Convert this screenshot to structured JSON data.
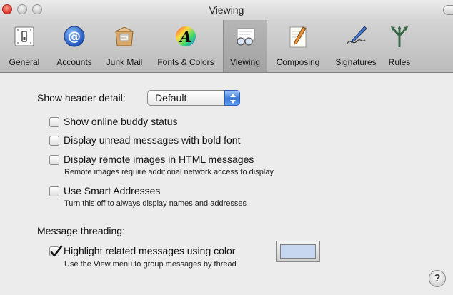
{
  "window": {
    "title": "Viewing"
  },
  "toolbar": {
    "items": [
      {
        "label": "General",
        "icon": "general-switch-icon"
      },
      {
        "label": "Accounts",
        "icon": "at-sign-icon"
      },
      {
        "label": "Junk Mail",
        "icon": "junk-mail-icon"
      },
      {
        "label": "Fonts & Colors",
        "icon": "fonts-colors-icon"
      },
      {
        "label": "Viewing",
        "icon": "viewing-glasses-icon",
        "selected": true
      },
      {
        "label": "Composing",
        "icon": "composing-pencil-icon"
      },
      {
        "label": "Signatures",
        "icon": "signature-pen-icon"
      },
      {
        "label": "Rules",
        "icon": "rules-arrows-icon"
      }
    ]
  },
  "header_detail": {
    "label": "Show header detail:",
    "selected": "Default"
  },
  "options": {
    "buddy_status": {
      "label": "Show online buddy status",
      "checked": false
    },
    "bold_unread": {
      "label": "Display unread messages with bold font",
      "checked": false
    },
    "remote_images": {
      "label": "Display remote images in HTML messages",
      "note": "Remote images require additional network access to display",
      "checked": false
    },
    "smart_addresses": {
      "label": "Use Smart Addresses",
      "note": "Turn this off to always display names and addresses",
      "checked": false
    }
  },
  "threading": {
    "section_label": "Message threading:",
    "highlight": {
      "label": "Highlight related messages using color",
      "note": "Use the View menu to group messages by thread",
      "checked": true,
      "color": "#c7d7ef"
    }
  },
  "help": {
    "label": "?"
  }
}
